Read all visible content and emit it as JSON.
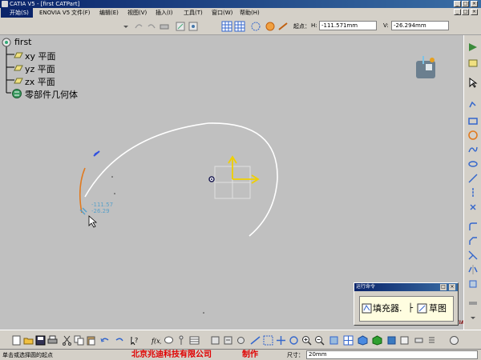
{
  "window": {
    "title": "CATIA V5 - [first CATPart]"
  },
  "menu": {
    "start": "开始(S)",
    "items": [
      "ENOVIA V5",
      "文件(F)",
      "编辑(E)",
      "视图(V)",
      "插入(I)",
      "工具(T)",
      "窗口(W)",
      "帮助(H)"
    ]
  },
  "coords": {
    "point_label": "起点：",
    "h_label": "H:",
    "h_value": "-111.571mm",
    "v_label": "V:",
    "v_value": "-26.294mm"
  },
  "tree": {
    "root": "first",
    "items": [
      "xy 平面",
      "yz 平面",
      "zx 平面"
    ],
    "body": "零部件几何体"
  },
  "cursor_readout": {
    "h": "-111.57",
    "v": "-26.29"
  },
  "command_panel": {
    "title": "运行命令",
    "filler": "填充器.",
    "sketch": "草图"
  },
  "status": {
    "message": "单击或选择圆的起点",
    "company": "北京兆迪科技有限公司",
    "made": "制作",
    "size_label": "尺寸：",
    "size_value": "20mm"
  },
  "brand": "CATIA",
  "colors": {
    "title_bar": "#0a246a",
    "viewport": "#c0c0c0",
    "arc": "#ffffff",
    "arc_preview": "#e07a20",
    "axis": "#f0d000",
    "readout": "#5aa0c8",
    "company_text": "#e00000"
  }
}
